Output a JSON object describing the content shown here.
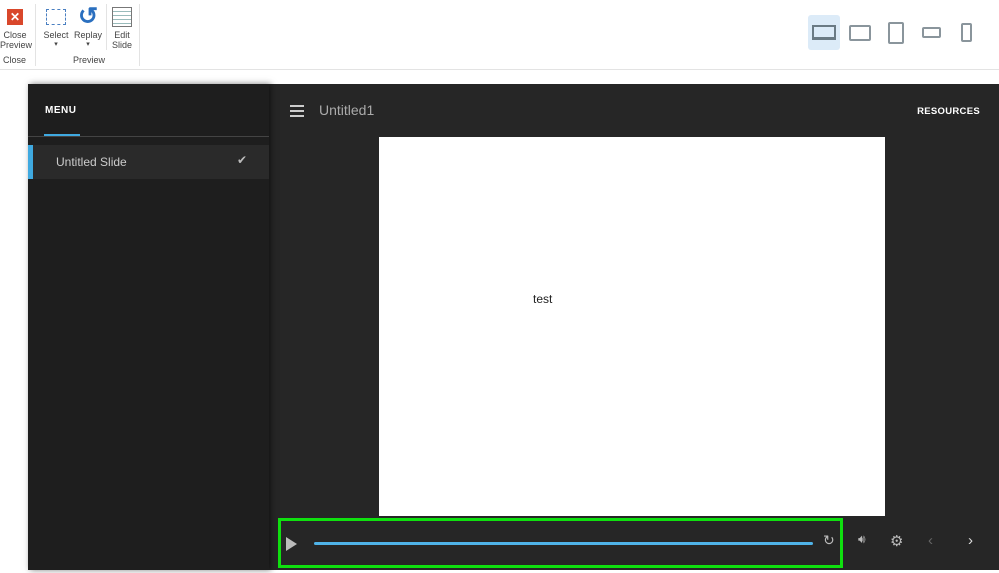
{
  "ribbon": {
    "close_preview": "Close\nPreview",
    "close_group": "Close",
    "select": "Select",
    "replay": "Replay",
    "edit_slide": "Edit\nSlide",
    "preview_group": "Preview",
    "devices": [
      "desktop",
      "tablet-landscape",
      "tablet-portrait",
      "phone-landscape",
      "phone-portrait"
    ],
    "selected_device": "desktop"
  },
  "player": {
    "menu_title": "MENU",
    "menu_items": [
      {
        "label": "Untitled Slide",
        "visited": true
      }
    ],
    "course_title": "Untitled1",
    "resources": "RESOURCES",
    "slide_text": "test",
    "progress": 1.0,
    "accent": "#3fa9e0"
  }
}
